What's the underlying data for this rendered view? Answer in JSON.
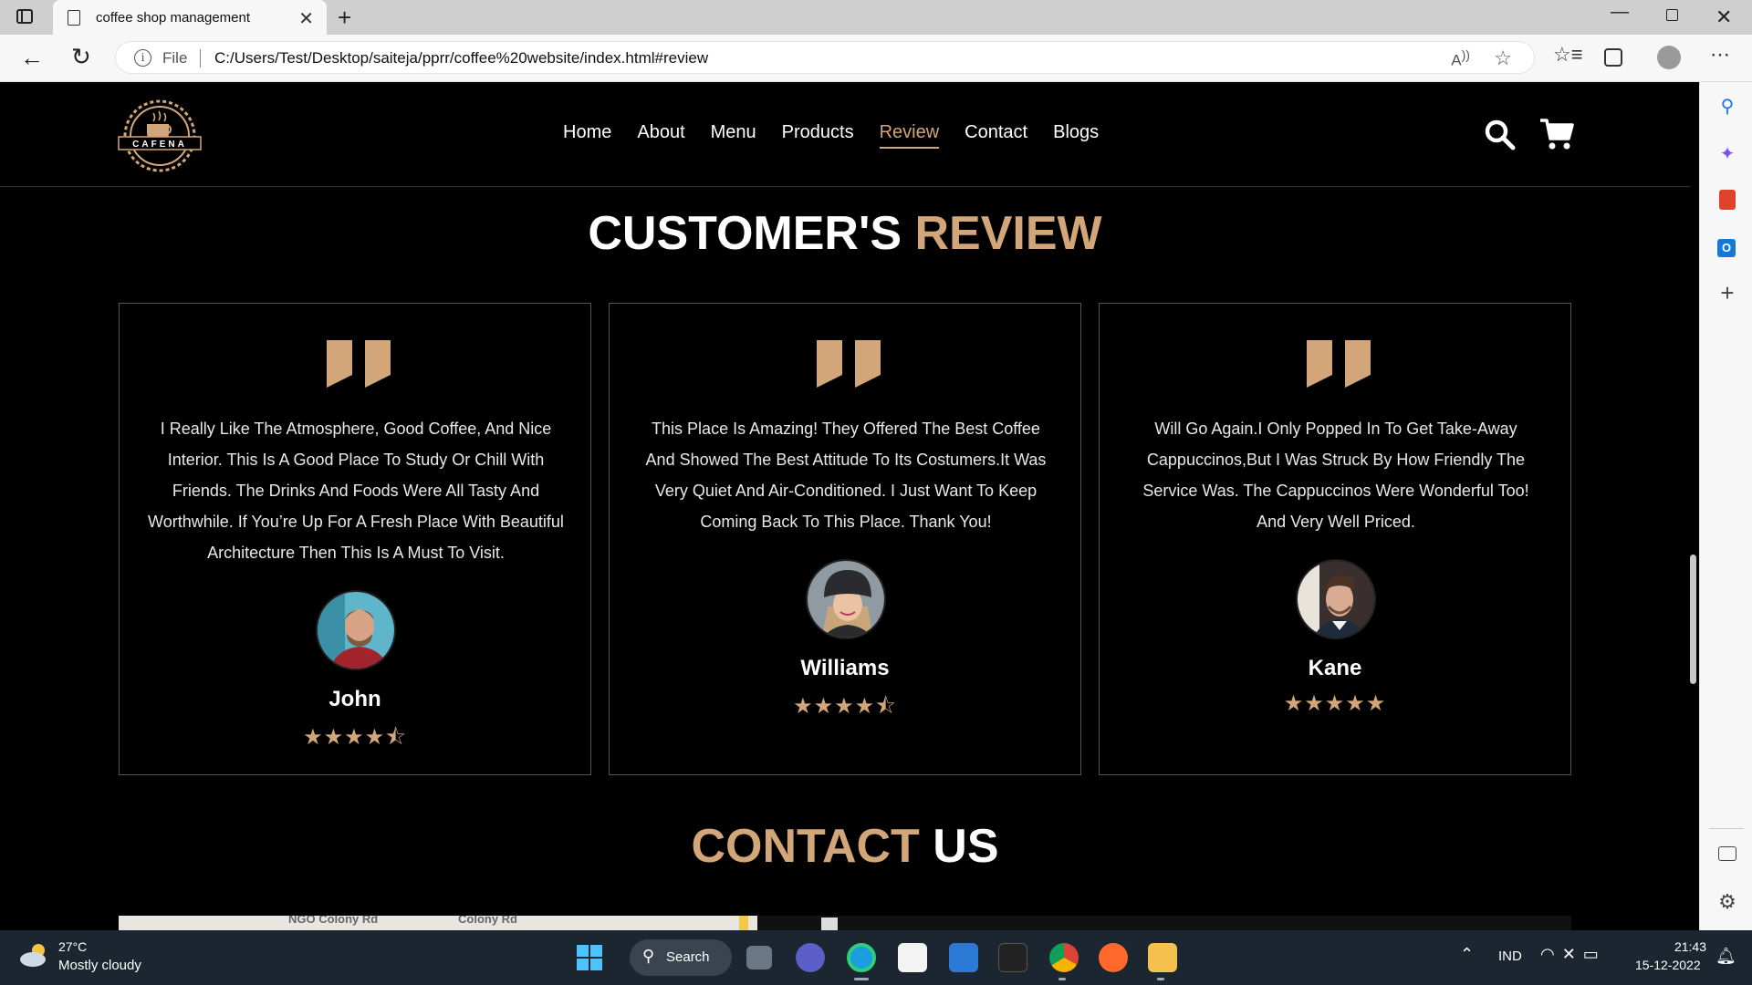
{
  "browser": {
    "tab_title": "coffee shop management",
    "address_prefix": "File",
    "url": "C:/Users/Test/Desktop/saiteja/pprr/coffee%20website/index.html#review"
  },
  "site": {
    "nav": [
      "Home",
      "About",
      "Menu",
      "Products",
      "Review",
      "Contact",
      "Blogs"
    ],
    "active_nav": "Review",
    "logo_text": "CAFENA",
    "review_title": {
      "main": "CUSTOMER'S",
      "accent": "REVIEW"
    },
    "contact_title": {
      "accent": "CONTACT",
      "main": "US"
    },
    "reviews": [
      {
        "text": "I Really Like The Atmosphere, Good Coffee, And Nice Interior. This Is A Good Place To Study Or Chill With Friends. The Drinks And Foods Were All Tasty And Worthwhile. If You’re Up For A Fresh Place With Beautiful Architecture Then This Is A Must To Visit.",
        "name": "John",
        "rating": 4.5,
        "stars": "★★★★⯪"
      },
      {
        "text": "This Place Is Amazing! They Offered The Best Coffee And Showed The Best Attitude To Its Costumers.It Was Very Quiet And Air-Conditioned. I Just Want To Keep Coming Back To This Place. Thank You!",
        "name": "Williams",
        "rating": 4.5,
        "stars": "★★★★⯪"
      },
      {
        "text": "Will Go Again.I Only Popped In To Get Take-Away Cappuccinos,But I Was Struck By How Friendly The Service Was. The Cappuccinos Were Wonderful Too! And Very Well Priced.",
        "name": "Kane",
        "rating": 5,
        "stars": "★★★★★"
      }
    ],
    "map_labels": [
      "NGO Colony Rd",
      "Colony Rd"
    ]
  },
  "taskbar": {
    "weather_temp": "27°C",
    "weather_desc": "Mostly cloudy",
    "search_label": "Search",
    "language": "IND",
    "time": "21:43",
    "date": "15-12-2022"
  },
  "colors": {
    "accent": "#d2a679",
    "background": "#000000"
  }
}
